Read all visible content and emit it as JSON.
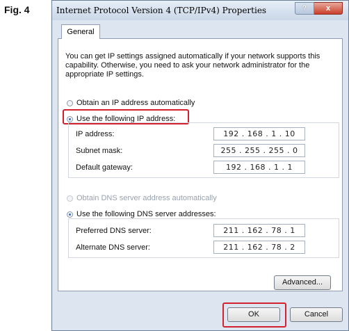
{
  "figure_label": "Fig. 4",
  "window": {
    "title": "Internet Protocol Version 4 (TCP/IPv4) Properties",
    "help_glyph": "?",
    "close_glyph": "x"
  },
  "tabs": [
    {
      "label": "General"
    }
  ],
  "description": "You can get IP settings assigned automatically if your network supports this capability. Otherwise, you need to ask your network administrator for the appropriate IP settings.",
  "ip_mode": {
    "auto_label": "Obtain an IP address automatically",
    "manual_label": "Use the following IP address:",
    "selected": "manual"
  },
  "ip_fields": [
    {
      "label": "IP address:",
      "value": "192 . 168 . 1 . 10"
    },
    {
      "label": "Subnet mask:",
      "value": "255 . 255 . 255 . 0"
    },
    {
      "label": "Default gateway:",
      "value": "192 . 168 . 1 . 1"
    }
  ],
  "dns_mode": {
    "auto_label": "Obtain DNS server address automatically",
    "manual_label": "Use the following DNS server addresses:",
    "selected": "manual"
  },
  "dns_fields": [
    {
      "label": "Preferred DNS server:",
      "value": "211 . 162 . 78 . 1"
    },
    {
      "label": "Alternate DNS server:",
      "value": "211 . 162 . 78 . 2"
    }
  ],
  "buttons": {
    "advanced": "Advanced...",
    "ok": "OK",
    "cancel": "Cancel"
  },
  "colors": {
    "highlight": "#d2202c",
    "radio_selected": "#2b6fc8"
  }
}
